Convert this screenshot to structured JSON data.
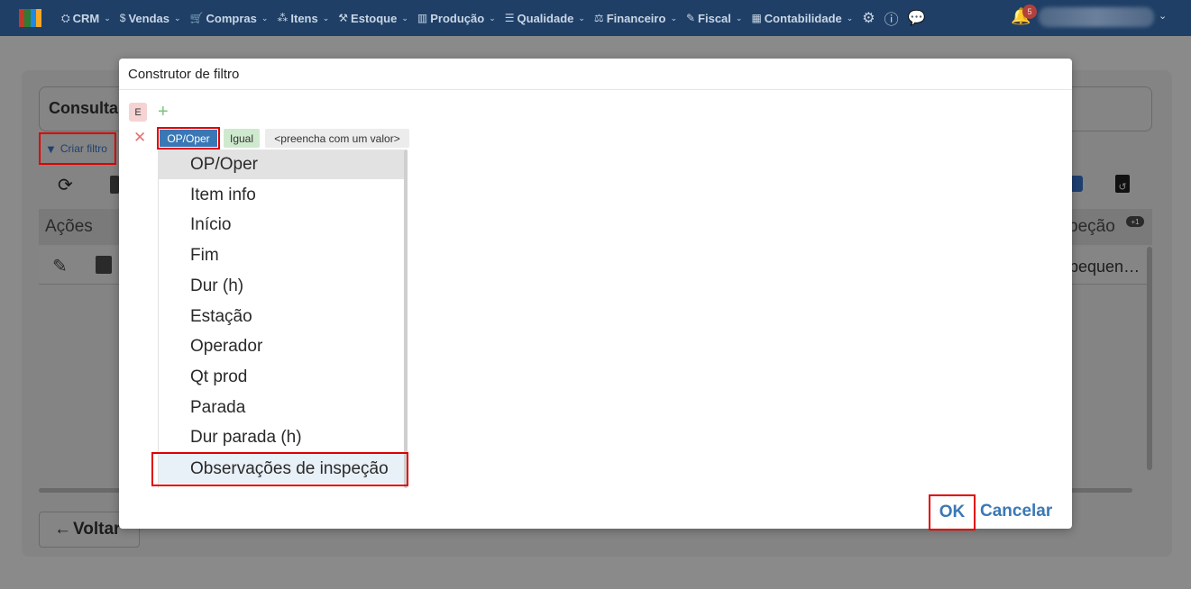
{
  "topbar": {
    "logo_colors": [
      "#c0392b",
      "#2e7d32",
      "#1e88e5",
      "#f9a825"
    ],
    "nav": [
      {
        "label": "CRM",
        "icon": "crm-icon"
      },
      {
        "label": "Vendas",
        "icon": "dollar-icon"
      },
      {
        "label": "Compras",
        "icon": "cart-icon"
      },
      {
        "label": "Itens",
        "icon": "items-icon"
      },
      {
        "label": "Estoque",
        "icon": "stock-icon"
      },
      {
        "label": "Produção",
        "icon": "production-icon"
      },
      {
        "label": "Qualidade",
        "icon": "quality-icon"
      },
      {
        "label": "Financeiro",
        "icon": "finance-icon"
      },
      {
        "label": "Fiscal",
        "icon": "fiscal-icon"
      },
      {
        "label": "Contabilidade",
        "icon": "accounting-icon"
      }
    ],
    "notifications_count": "5"
  },
  "background": {
    "title": "Consultar",
    "criar_filtro": "Criar filtro",
    "column_acoes": "Ações",
    "column_inspecao": "peção",
    "column_badge": "+1",
    "cell_text": "pequen…",
    "voltar": "Voltar"
  },
  "modal": {
    "title": "Construtor de filtro",
    "group_label": "E",
    "field": "OP/Oper",
    "operator": "Igual",
    "value_placeholder": "<preencha com um valor>",
    "options": [
      "OP/Oper",
      "Item info",
      "Início",
      "Fim",
      "Dur (h)",
      "Estação",
      "Operador",
      "Qt prod",
      "Parada",
      "Dur parada (h)",
      "Observações de inspeção"
    ],
    "ok": "OK",
    "cancel": "Cancelar"
  }
}
